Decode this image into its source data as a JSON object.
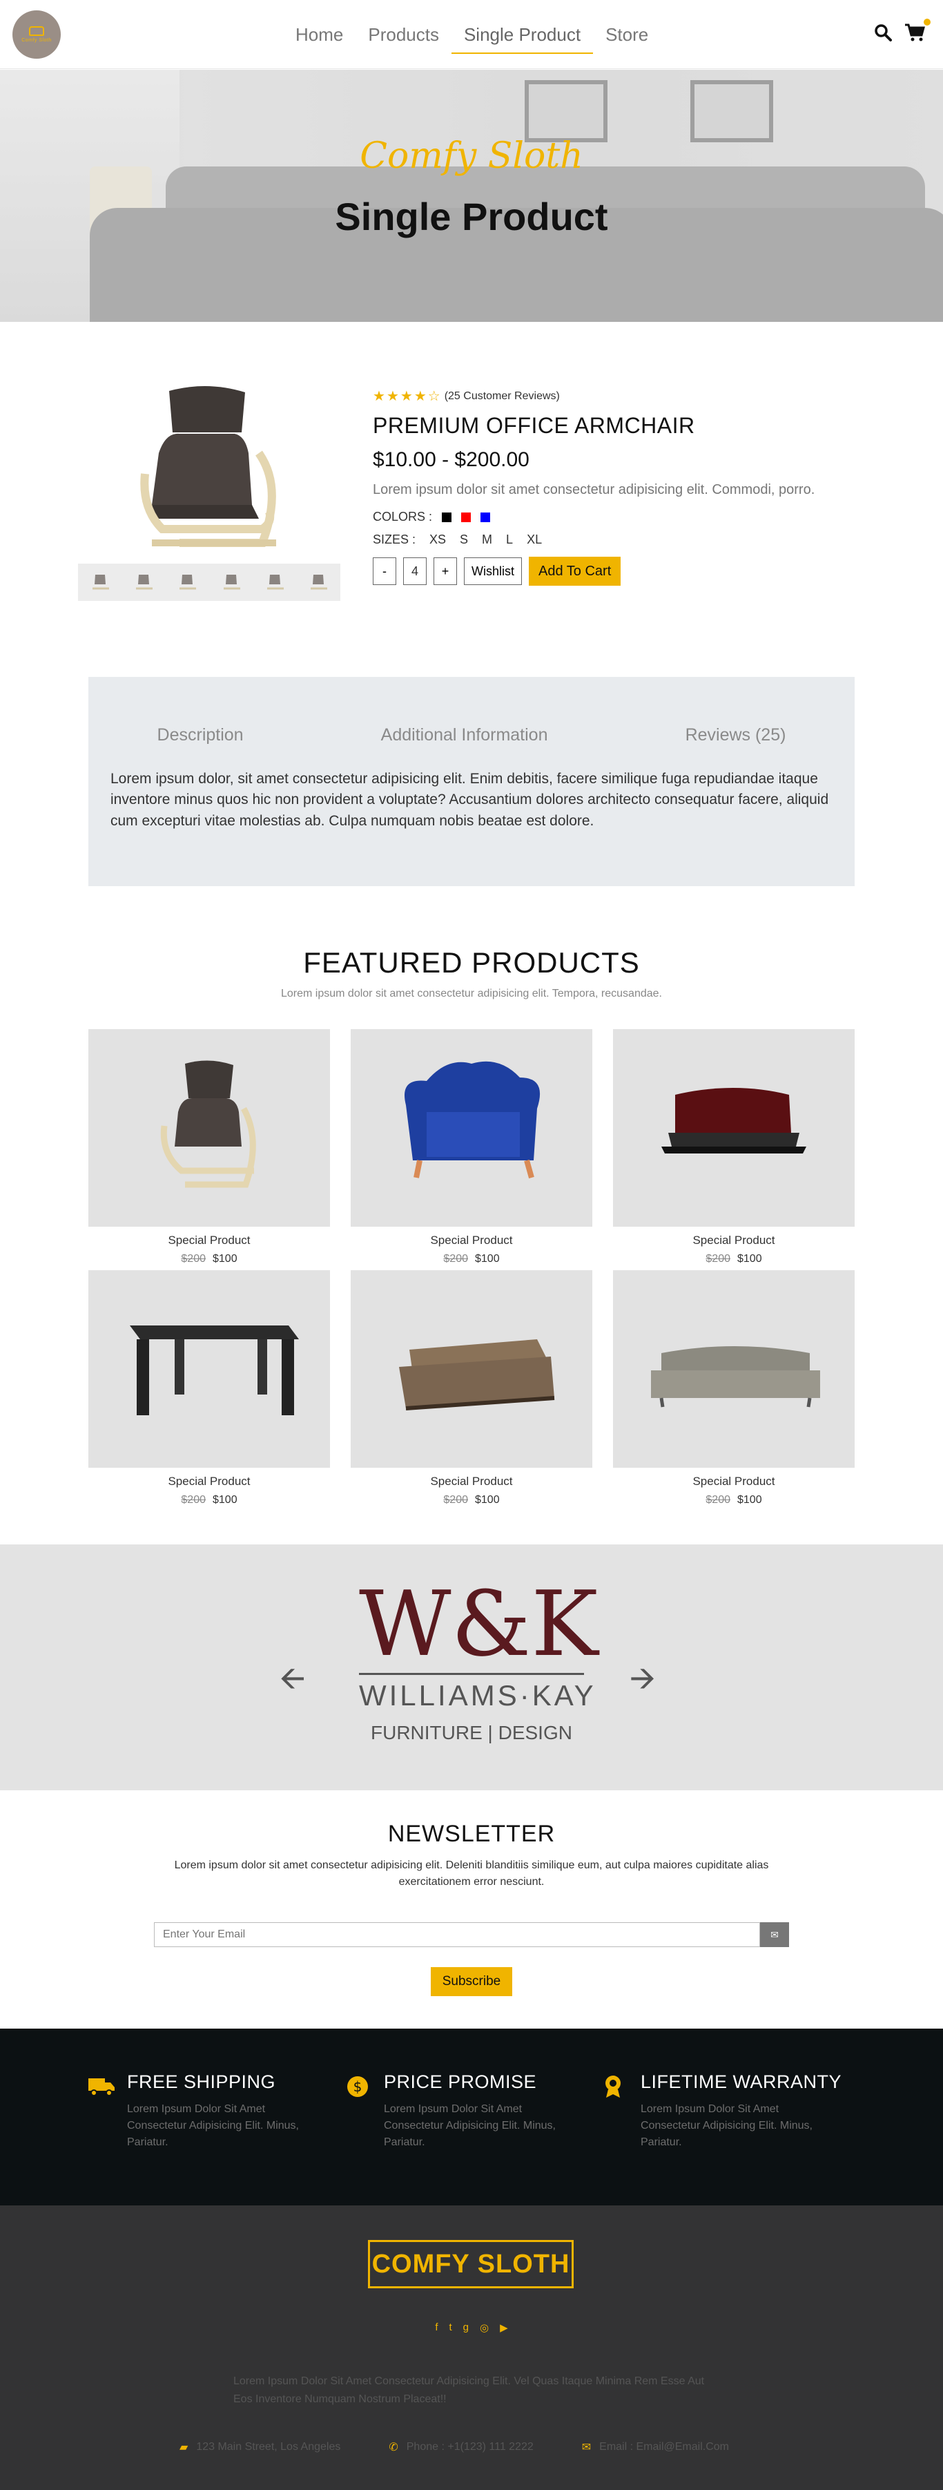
{
  "nav": {
    "logo_text": "Comfy Sloth",
    "links": [
      "Home",
      "Products",
      "Single Product",
      "Store"
    ]
  },
  "hero": {
    "subtitle": "Comfy Sloth",
    "title": "Single Product"
  },
  "product": {
    "rating": 4,
    "reviews": "(25 Customer Reviews)",
    "name": "PREMIUM OFFICE ARMCHAIR",
    "price": "$10.00 - $200.00",
    "description": "Lorem ipsum dolor sit amet consectetur adipisicing elit. Commodi, porro.",
    "colors_label": "COLORS :",
    "colors": [
      "#000000",
      "#ff0000",
      "#0000ff"
    ],
    "sizes_label": "SIZES :",
    "sizes": [
      "XS",
      "S",
      "M",
      "L",
      "XL"
    ],
    "qty_minus": "-",
    "qty": "4",
    "qty_plus": "+",
    "wishlist": "Wishlist",
    "add_to_cart": "Add To Cart"
  },
  "tabs": {
    "labels": [
      "Description",
      "Additional Information",
      "Reviews (25)"
    ],
    "content": "Lorem ipsum dolor, sit amet consectetur adipisicing elit. Enim debitis, facere similique fuga repudiandae itaque inventore minus quos hic non provident a voluptate? Accusantium dolores architecto consequatur facere, aliquid cum excepturi vitae molestias ab. Culpa numquam nobis beatae est dolore."
  },
  "featured": {
    "title": "FEATURED PRODUCTS",
    "subtitle": "Lorem ipsum dolor sit amet consectetur adipisicing elit. Tempora, recusandae.",
    "items": [
      {
        "name": "Special Product",
        "old": "$200",
        "price": "$100"
      },
      {
        "name": "Special Product",
        "old": "$200",
        "price": "$100"
      },
      {
        "name": "Special Product",
        "old": "$200",
        "price": "$100"
      },
      {
        "name": "Special Product",
        "old": "$200",
        "price": "$100"
      },
      {
        "name": "Special Product",
        "old": "$200",
        "price": "$100"
      },
      {
        "name": "Special Product",
        "old": "$200",
        "price": "$100"
      }
    ]
  },
  "brand": {
    "letters": "W&K",
    "name": "WILLIAMS·KAY",
    "tagline": "FURNITURE | DESIGN"
  },
  "newsletter": {
    "title": "NEWSLETTER",
    "text": "Lorem ipsum dolor sit amet consectetur adipisicing elit. Deleniti blanditiis similique eum, aut culpa maiores cupiditate alias exercitationem error nesciunt.",
    "placeholder": "Enter Your Email",
    "button": "Subscribe"
  },
  "services": [
    {
      "title": "FREE SHIPPING",
      "text": "Lorem Ipsum Dolor Sit Amet Consectetur Adipisicing Elit. Minus, Pariatur."
    },
    {
      "title": "PRICE PROMISE",
      "text": "Lorem Ipsum Dolor Sit Amet Consectetur Adipisicing Elit. Minus, Pariatur."
    },
    {
      "title": "LIFETIME WARRANTY",
      "text": "Lorem Ipsum Dolor Sit Amet Consectetur Adipisicing Elit. Minus, Pariatur."
    }
  ],
  "footer": {
    "logo": "COMFY SLOTH",
    "description": "Lorem Ipsum Dolor Sit Amet Consectetur Adipisicing Elit. Vel Quas Itaque Minima Rem Esse Aut Eos Inventore Numquam Nostrum Placeat!!",
    "address": "123 Main Street, Los Angeles",
    "phone": "Phone : +1(123) 111 2222",
    "email": "Email : Email@Email.Com"
  },
  "colors": {
    "accent": "#f0b400",
    "dark": "#0c1113",
    "footer": "#333334"
  }
}
